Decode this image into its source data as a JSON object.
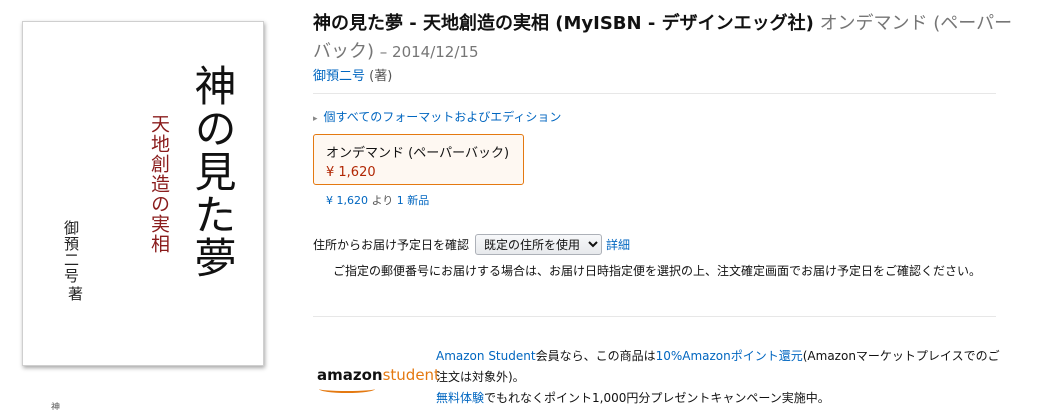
{
  "cover": {
    "title": "神の見た夢",
    "subtitle": "天地創造の実相",
    "author": "御預二号",
    "author_suffix": "著",
    "thumb_text": "神"
  },
  "product": {
    "title": "神の見た夢 - 天地創造の実相 (MyISBN - デザインエッグ社)",
    "format": "オンデマンド (ペーパーバック)",
    "date": "– 2014/12/15",
    "author": "御預二号",
    "author_role": "(著)"
  },
  "formats": {
    "all_formats_label": "個すべてのフォーマットおよびエディション",
    "swatch_label": "オンデマンド (ペーパーバック)",
    "swatch_price": "¥ 1,620",
    "offers_price": "¥ 1,620",
    "offers_mid": "より",
    "offers_link": "1 新品"
  },
  "delivery": {
    "label": "住所からお届け予定日を確認",
    "select_value": "既定の住所を使用",
    "detail_link": "詳細",
    "note": "ご指定の郵便番号にお届けする場合は、お届け日時指定便を選択の上、注文確定画面でお届け予定日をご確認ください。"
  },
  "student": {
    "logo_amazon": "amazon",
    "logo_student": "student",
    "link1": "Amazon Student",
    "text1": "会員なら、この商品は",
    "link2": "10%Amazonポイント還元",
    "text2": "(Amazonマーケットプレイスでのご注文は対象外)。",
    "link3": "無料体験",
    "text3": "でもれなくポイント1,000円分プレゼントキャンペーン実施中。"
  },
  "colors": {
    "link": "#0066c0",
    "price": "#b12704",
    "accent": "#e47911",
    "cover_subtitle": "#8a1c1c"
  }
}
